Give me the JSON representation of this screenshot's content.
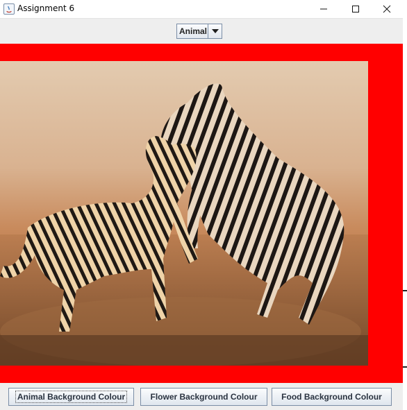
{
  "window": {
    "title": "Assignment 6",
    "controls": {
      "minimize_icon": "minimize-icon",
      "maximize_icon": "maximize-icon",
      "close_icon": "close-icon"
    }
  },
  "toolbar": {
    "category_select": {
      "selected": "Animal"
    }
  },
  "canvas": {
    "background_color": "#ff0000",
    "image_subject": "zebras"
  },
  "buttons": {
    "animal": "Animal Background Colour",
    "flower": "Flower Background Colour",
    "food": "Food Background Colour"
  }
}
